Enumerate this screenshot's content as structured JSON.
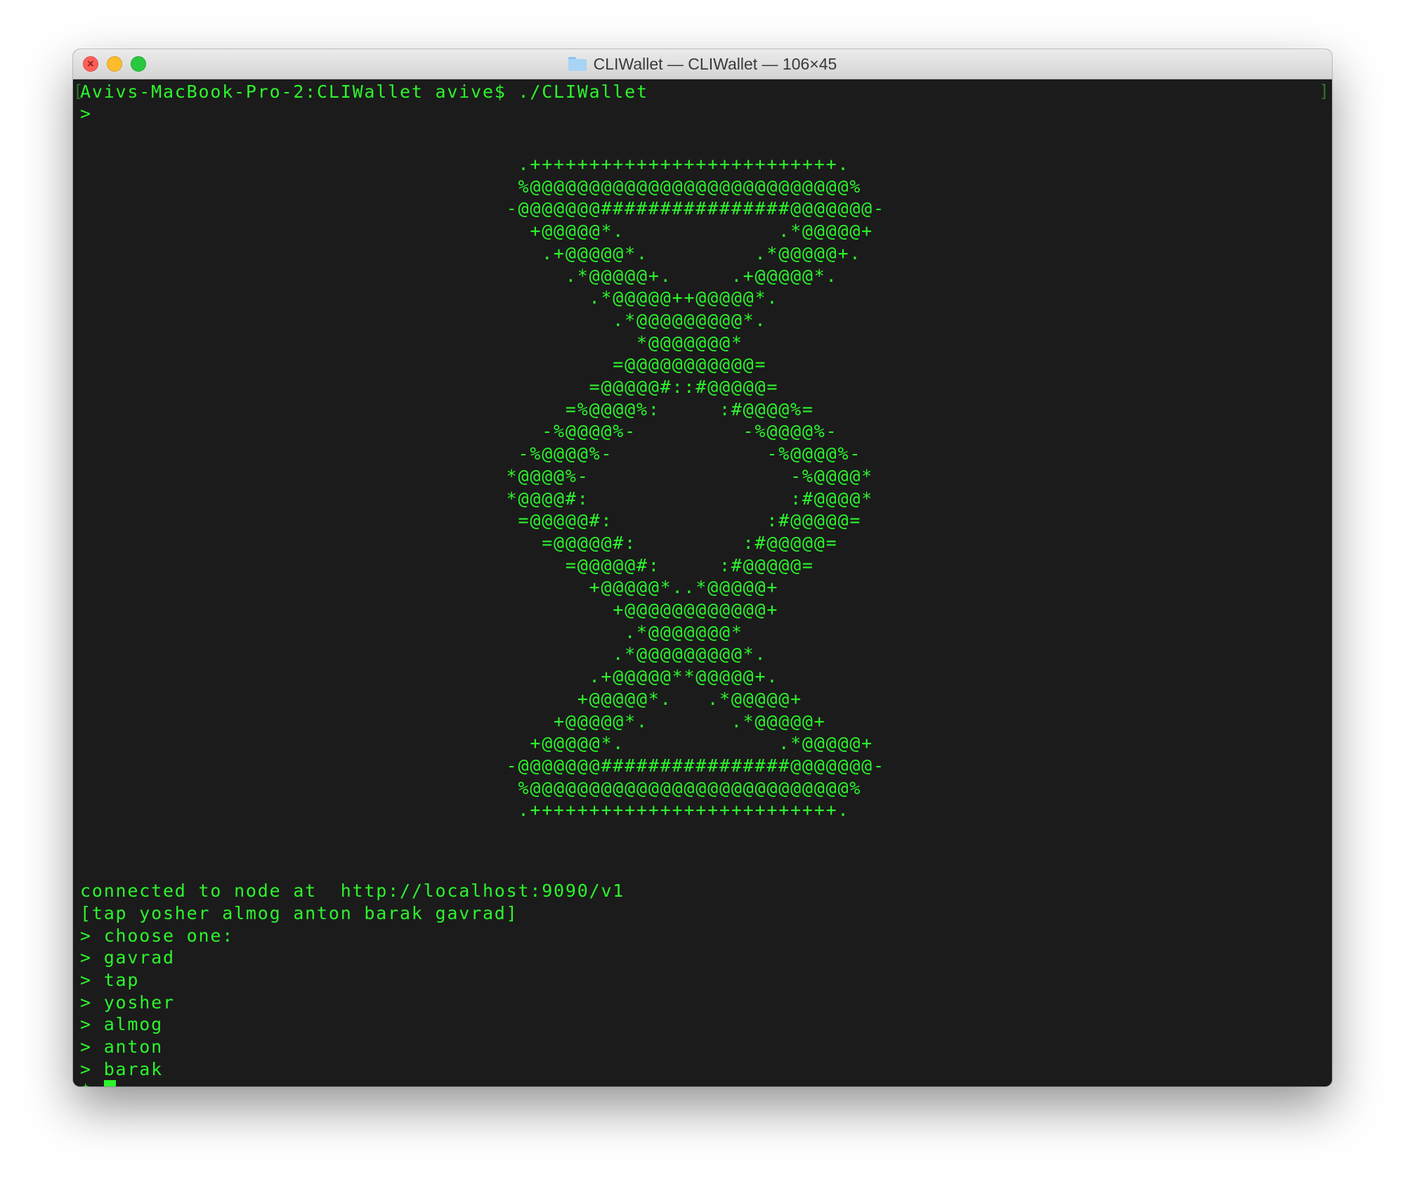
{
  "window": {
    "title": "CLIWallet — CLIWallet — 106×45"
  },
  "terminal": {
    "command_line": "Avivs-MacBook-Pro-2:CLIWallet avive$ ./CLIWallet",
    "prompt_line": ">",
    "ascii_art": "                                     .++++++++++++++++++++++++++.\n                                     %@@@@@@@@@@@@@@@@@@@@@@@@@@@%\n                                    -@@@@@@@################@@@@@@@-\n                                      +@@@@@*.             .*@@@@@+\n                                       .+@@@@@*.         .*@@@@@+.\n                                         .*@@@@@+.     .+@@@@@*.\n                                           .*@@@@@++@@@@@*.\n                                             .*@@@@@@@@@*.\n                                               *@@@@@@@*\n                                             =@@@@@@@@@@@=\n                                           =@@@@@#::#@@@@@=\n                                         =%@@@@%:     :#@@@@%=\n                                       -%@@@@%-         -%@@@@%-\n                                     -%@@@@%-             -%@@@@%-\n                                    *@@@@%-                 -%@@@@*\n                                    *@@@@#:                 :#@@@@*\n                                     =@@@@@#:             :#@@@@@=\n                                       =@@@@@#:         :#@@@@@=\n                                         =@@@@@#:     :#@@@@@=\n                                           +@@@@@*..*@@@@@+\n                                             +@@@@@@@@@@@@+\n                                              .*@@@@@@@*\n                                             .*@@@@@@@@@*.\n                                           .+@@@@@**@@@@@+.\n                                          +@@@@@*.   .*@@@@@+\n                                        +@@@@@*.       .*@@@@@+\n                                      +@@@@@*.             .*@@@@@+\n                                    -@@@@@@@################@@@@@@@-\n                                     %@@@@@@@@@@@@@@@@@@@@@@@@@@@%\n                                     .++++++++++++++++++++++++++.",
    "connection": "connected to node at  http://localhost:9090/v1",
    "accounts_list": "[tap yosher almog anton barak gavrad]",
    "choose_prompt": "> choose one:",
    "options": [
      "> gavrad",
      "> tap",
      "> yosher",
      "> almog",
      "> anton",
      "> barak"
    ],
    "shell_prompt": "$"
  }
}
